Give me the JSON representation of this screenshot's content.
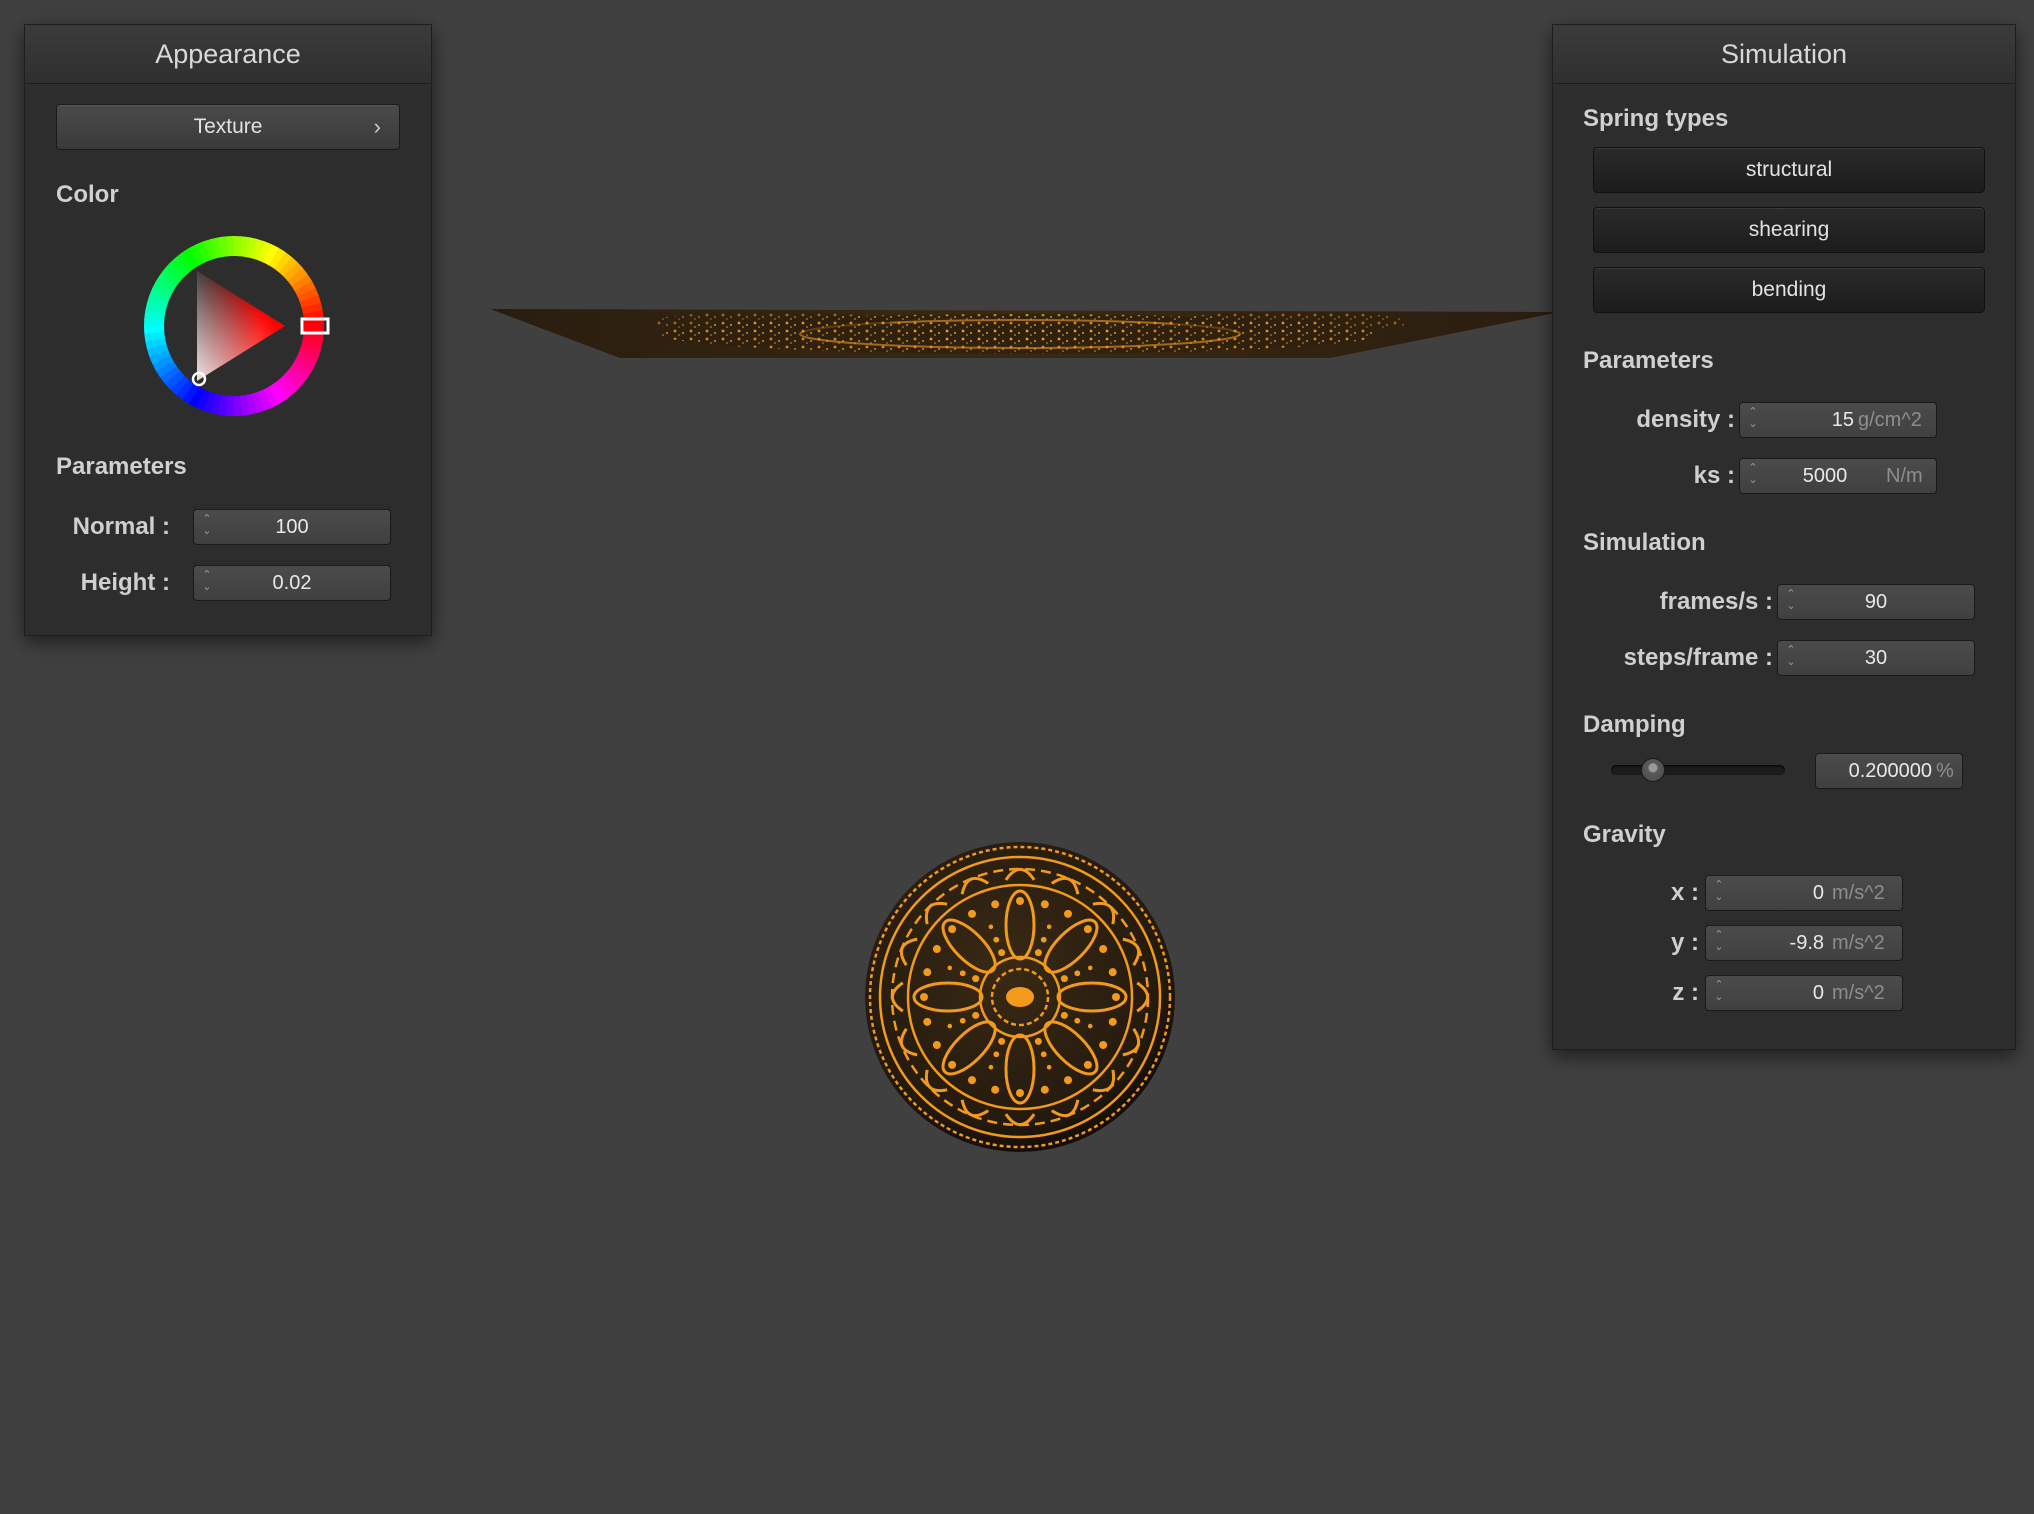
{
  "appearance": {
    "title": "Appearance",
    "texture_button": "Texture",
    "color_section": "Color",
    "selected_color": "#ff0000",
    "parameters_section": "Parameters",
    "normal": {
      "label": "Normal :",
      "value": "100"
    },
    "height": {
      "label": "Height :",
      "value": "0.02"
    }
  },
  "simulation": {
    "title": "Simulation",
    "spring_types_section": "Spring types",
    "spring_buttons": [
      "structural",
      "shearing",
      "bending"
    ],
    "parameters_section": "Parameters",
    "density": {
      "label": "density :",
      "value": "15",
      "unit": "g/cm^2"
    },
    "ks": {
      "label": "ks :",
      "value": "5000",
      "unit": "N/m"
    },
    "simulation_section": "Simulation",
    "frames_per_s": {
      "label": "frames/s :",
      "value": "90"
    },
    "steps_per_frame": {
      "label": "steps/frame :",
      "value": "30"
    },
    "damping_section": "Damping",
    "damping": {
      "value": "0.200000",
      "unit": "%",
      "slider_fraction": 0.2
    },
    "gravity_section": "Gravity",
    "gravity_x": {
      "label": "x :",
      "value": "0",
      "unit": "m/s^2"
    },
    "gravity_y": {
      "label": "y :",
      "value": "-9.8",
      "unit": "m/s^2"
    },
    "gravity_z": {
      "label": "z :",
      "value": "0",
      "unit": "m/s^2"
    }
  },
  "scene": {
    "background": "#404040",
    "texture_color": "#f29a1c",
    "texture_dark": "#2a1d10"
  }
}
